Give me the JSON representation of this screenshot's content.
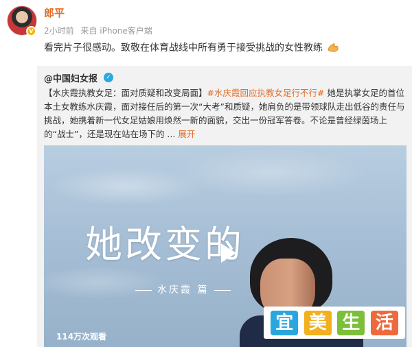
{
  "post": {
    "author": "郎平",
    "time": "2小时前",
    "source": "来自 iPhone客户端",
    "text": "看完片子很感动。致敬在体育战线中所有勇于接受挑战的女性教练"
  },
  "repost": {
    "author": "@中国妇女报",
    "text_lead": "【水庆霞执教女足：面对质疑和改变局面】",
    "topic": "#水庆霞回应执教女足行不行#",
    "text_body": " 她是执掌女足的首位本土女教练水庆霞，面对接任后的第一次“大考”和质疑，她肩负的是带领球队走出低谷的责任与挑战，她携着新一代女足姑娘用焕然一新的面貌，交出一份冠军答卷。不论是曾经绿茵场上的“战士”，还是现在站在场下的 ...",
    "more": "展开",
    "video": {
      "title": "她改变的",
      "subtitle": "水庆霞 篇",
      "views": "114万次观看"
    }
  },
  "watermark": {
    "chars": [
      "宜",
      "美",
      "生",
      "活"
    ],
    "colors": [
      "#2aa6de",
      "#f2b01e",
      "#7cbf3a",
      "#ee6a3c"
    ]
  },
  "colors": {
    "accent": "#e16e2a",
    "verified": "#2aa9e0",
    "vip": "#f5b400"
  }
}
